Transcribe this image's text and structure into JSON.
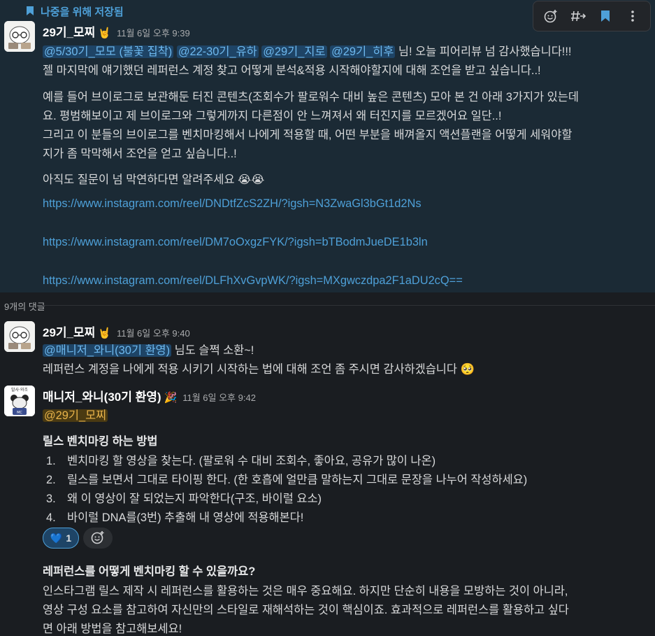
{
  "saved_banner": {
    "label": "나중을 위해 저장됨"
  },
  "toolbar": {
    "icons": [
      "add-reaction-icon",
      "forward-thread-icon",
      "bookmark-icon",
      "more-icon"
    ]
  },
  "post": {
    "author": "29기_모찌",
    "badge": "🤘",
    "time": "11월 6일 오후 9:39",
    "mentions": [
      "@5/30기_모모 (불꽃 집착)",
      "@22-30기_유하",
      "@29기_지로",
      "@29기_히후"
    ],
    "line1_tail": "님! 오늘 피어리뷰 넘 감사했습니다!!!",
    "line2": "젤 마지막에 얘기했던 레퍼런스 계정 찾고 어떻게 분석&적용 시작해야할지에 대해 조언을 받고 싶습니다..!",
    "para2": [
      "예를 들어 브이로그로 보관해둔 터진 콘텐츠(조회수가 팔로워수 대비 높은 콘텐츠) 모아 본 건 아래 3가지가 있는데",
      "요. 평범해보이고 제 브이로그와 그렇게까지 다른점이 안 느껴져서 왜 터진지를 모르겠어요 일단..!",
      "그리고 이 분들의 브이로그를 벤치마킹해서 나에게 적용할 때, 어떤 부분을 배껴올지 액션플랜을 어떻게 세워야할",
      "지가 좀 막막해서 조언을 얻고 싶습니다..!"
    ],
    "para3": "아직도 질문이 넘 막연하다면 알려주세요 😭😭",
    "links": [
      "https://www.instagram.com/reel/DNDtfZcS2ZH/?igsh=N3ZwaGl3bGt1d2Ns",
      "https://www.instagram.com/reel/DM7oOxgzFYK/?igsh=bTBodmJueDE1b3ln",
      "https://www.instagram.com/reel/DLFhXvGvpWK/?igsh=MXgwczdpa2F1aDU2cQ=="
    ]
  },
  "comments_label": "9개의 댓글",
  "reply1": {
    "author": "29기_모찌",
    "badge": "🤘",
    "time": "11월 6일 오후 9:40",
    "mention": "@매니저_와니(30기 환영)",
    "line1_tail": "님도 슬쩍 소환~!",
    "line2": "레퍼런스 계정을 나에게 적용 시키기 시작하는 법에 대해 조언 좀 주시면 감사하겠습니다 🥺"
  },
  "reply2": {
    "author": "매니저_와니(30기 환영)",
    "badge": "🎉",
    "time": "11월 6일 오후 9:42",
    "mention": "@29기_모찌",
    "heading": "릴스 벤치마킹 하는 방법",
    "steps": [
      {
        "num": "1.",
        "text": "벤치마킹 할 영상을 찾는다. (팔로워 수 대비 조회수, 좋아요, 공유가 많이 나온)"
      },
      {
        "num": "2.",
        "text": "릴스를 보면서 그대로 타이핑 한다. (한 호흡에 얼만큼 말하는지 그대로 문장을 나누어 작성하세요)"
      },
      {
        "num": "3.",
        "text": "왜 이 영상이 잘 되었는지 파악한다(구조, 바이럴 요소)"
      },
      {
        "num": "4.",
        "text": "바이럴 DNA를(3번) 추출해 내 영상에 적용해본다!"
      }
    ],
    "reaction_emoji": "💙",
    "reaction_count": "1",
    "heading2": "레퍼런스를 어떻게 벤치마킹 할 수 있을까요?",
    "para": [
      "인스타그램 릴스 제작 시 레퍼런스를 활용하는 것은 매우 중요해요. 하지만 단순히 내용을 모방하는 것이 아니라,",
      "영상 구성 요소를 참고하여 자신만의 스타일로 재해석하는 것이 핵심이죠. 효과적으로 레퍼런스를 활용하고 싶다",
      "면 아래 방법을 참고해보세요!"
    ]
  }
}
